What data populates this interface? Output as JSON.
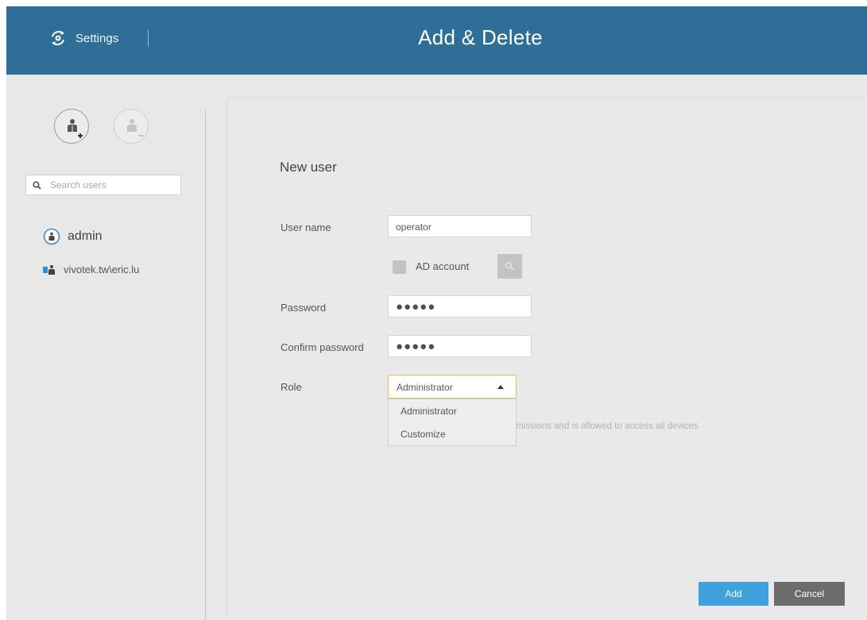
{
  "header": {
    "settings_label": "Settings",
    "title": "Add & Delete",
    "bg_color": "#2f6e96"
  },
  "sidebar": {
    "add_user_icon": "add-user-icon",
    "remove_user_icon": "remove-user-icon",
    "search": {
      "placeholder": "Search users",
      "value": ""
    },
    "users": [
      {
        "name": "admin",
        "icon": "user-circle-icon"
      },
      {
        "name": "vivotek.tw\\eric.lu",
        "icon": "ad-user-icon"
      }
    ]
  },
  "form": {
    "title": "New user",
    "username_label": "User name",
    "username_value": "operator",
    "ad_account_label": "AD account",
    "password_label": "Password",
    "password_value": "●●●●●",
    "confirm_label": "Confirm password",
    "confirm_value": "●●●●●",
    "role_label": "Role",
    "role_value": "Administrator",
    "role_options": [
      "Administrator",
      "Customize"
    ],
    "role_description": "ermissions and is allowed to access all devices"
  },
  "buttons": {
    "add": "Add",
    "cancel": "Cancel",
    "add_color": "#3fa2dc",
    "cancel_color": "#6c6c6c"
  }
}
